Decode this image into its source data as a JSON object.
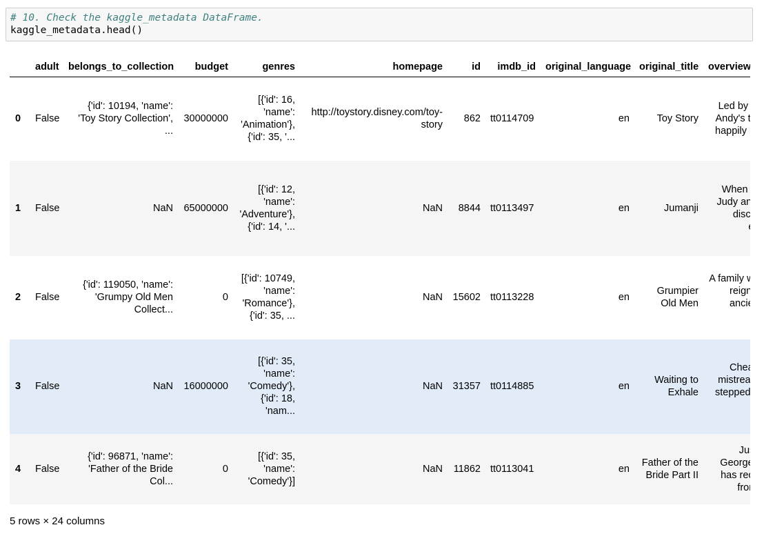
{
  "cell": {
    "comment": "# 10. Check the kaggle_metadata DataFrame.",
    "code": "kaggle_metadata.head()"
  },
  "table": {
    "columns": [
      "",
      "adult",
      "belongs_to_collection",
      "budget",
      "genres",
      "homepage",
      "id",
      "imdb_id",
      "original_language",
      "original_title",
      "overview"
    ],
    "rows": [
      {
        "index": "0",
        "adult": "False",
        "belongs_to_collection": "{'id': 10194, 'name': 'Toy Story Collection', ...",
        "budget": "30000000",
        "genres": "[{'id': 16, 'name': 'Animation'}, {'id': 35, '...",
        "homepage": "http://toystory.disney.com/toy-story",
        "id": "862",
        "imdb_id": "tt0114709",
        "original_language": "en",
        "original_title": "Toy Story",
        "overview": "Led by Woody, Andy's toys live happily in his ..."
      },
      {
        "index": "1",
        "adult": "False",
        "belongs_to_collection": "NaN",
        "budget": "65000000",
        "genres": "[{'id': 12, 'name': 'Adventure'}, {'id': 14, '...",
        "homepage": "NaN",
        "id": "8844",
        "imdb_id": "tt0113497",
        "original_language": "en",
        "original_title": "Jumanji",
        "overview": "When siblings Judy and Peter discover an encha..."
      },
      {
        "index": "2",
        "adult": "False",
        "belongs_to_collection": "{'id': 119050, 'name': 'Grumpy Old Men Collect...",
        "budget": "0",
        "genres": "[{'id': 10749, 'name': 'Romance'}, {'id': 35, ...",
        "homepage": "NaN",
        "id": "15602",
        "imdb_id": "tt0113228",
        "original_language": "en",
        "original_title": "Grumpier Old Men",
        "overview": "A family wedding reignites the ancient feud be..."
      },
      {
        "index": "3",
        "adult": "False",
        "belongs_to_collection": "NaN",
        "budget": "16000000",
        "genres": "[{'id': 35, 'name': 'Comedy'}, {'id': 18, 'nam...",
        "homepage": "NaN",
        "id": "31357",
        "imdb_id": "tt0114885",
        "original_language": "en",
        "original_title": "Waiting to Exhale",
        "overview": "Cheated on, mistreated and stepped on, the wom..."
      },
      {
        "index": "4",
        "adult": "False",
        "belongs_to_collection": "{'id': 96871, 'name': 'Father of the Bride Col...",
        "budget": "0",
        "genres": "[{'id': 35, 'name': 'Comedy'}]",
        "homepage": "NaN",
        "id": "11862",
        "imdb_id": "tt0113041",
        "original_language": "en",
        "original_title": "Father of the Bride Part II",
        "overview": "Just when George Banks has recovered from his ..."
      }
    ]
  },
  "shape_note": "5 rows × 24 columns"
}
